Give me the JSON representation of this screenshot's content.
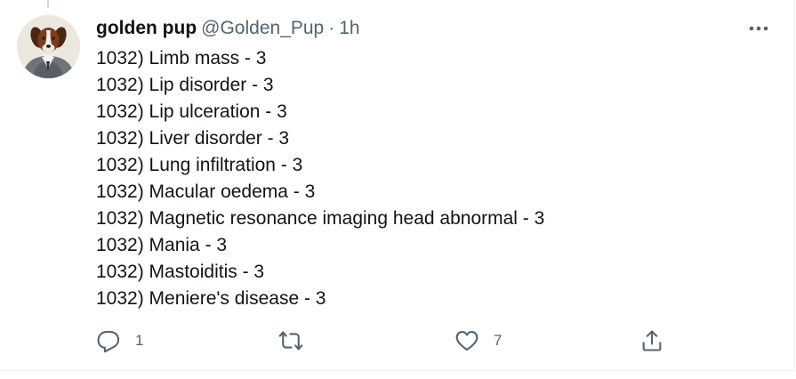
{
  "tweet": {
    "author": {
      "display_name": "golden pup",
      "handle": "@Golden_Pup",
      "separator": "·",
      "time": "1h"
    },
    "lines": [
      "1032) Limb mass - 3",
      "1032) Lip disorder - 3",
      "1032) Lip ulceration - 3",
      "1032) Liver disorder - 3",
      "1032) Lung infiltration - 3",
      "1032) Macular oedema - 3",
      "1032) Magnetic resonance imaging head abnormal - 3",
      "1032) Mania - 3",
      "1032) Mastoiditis - 3",
      "1032) Meniere's disease - 3"
    ],
    "actions": {
      "reply_count": "1",
      "retweet_count": "",
      "like_count": "7"
    }
  },
  "icons": {
    "reply": "reply-icon",
    "retweet": "retweet-icon",
    "like": "heart-icon",
    "share": "share-icon",
    "more": "more-icon"
  },
  "colors": {
    "text_primary": "#0f1419",
    "text_secondary": "#536471",
    "divider": "#eff3f4",
    "thread_line": "#cfd9de"
  }
}
